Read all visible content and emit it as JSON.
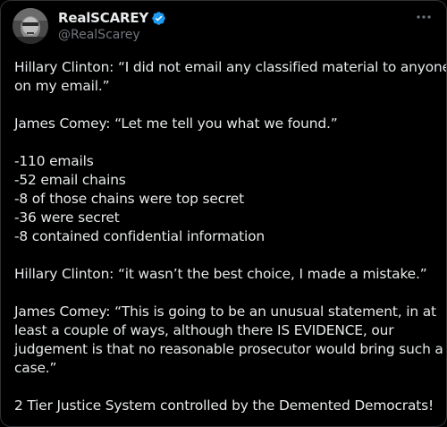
{
  "author": {
    "display_name": "RealSCAREY",
    "handle": "@RealScarey",
    "verified": true,
    "verified_color": "#1d9bf0"
  },
  "icons": {
    "verified": "verified-badge-icon",
    "more": "more-horizontal-icon",
    "avatar": "avatar"
  },
  "tweet": {
    "lines": [
      "Hillary Clinton:  “I did not email any classified material to anyone",
      "on my email.”",
      "",
      "James Comey:  “Let me tell you what we found.”",
      "",
      "-110 emails",
      "-52 email chains",
      "-8 of those chains were top secret",
      "-36 were secret",
      "-8 contained confidential information",
      "",
      "Hillary Clinton:  “it wasn’t the best choice, I made a mistake.”",
      "",
      "James Comey:  “This is going to be an unusual statement, in at",
      "least a couple of ways, although there IS EVIDENCE, our",
      "judgement is that no reasonable prosecutor would bring such a",
      "case.”",
      "",
      "2 Tier Justice System controlled by the Demented Democrats!"
    ]
  },
  "colors": {
    "background": "#000000",
    "text": "#e7e9ea",
    "secondary": "#71767b",
    "border": "#2f3336"
  }
}
